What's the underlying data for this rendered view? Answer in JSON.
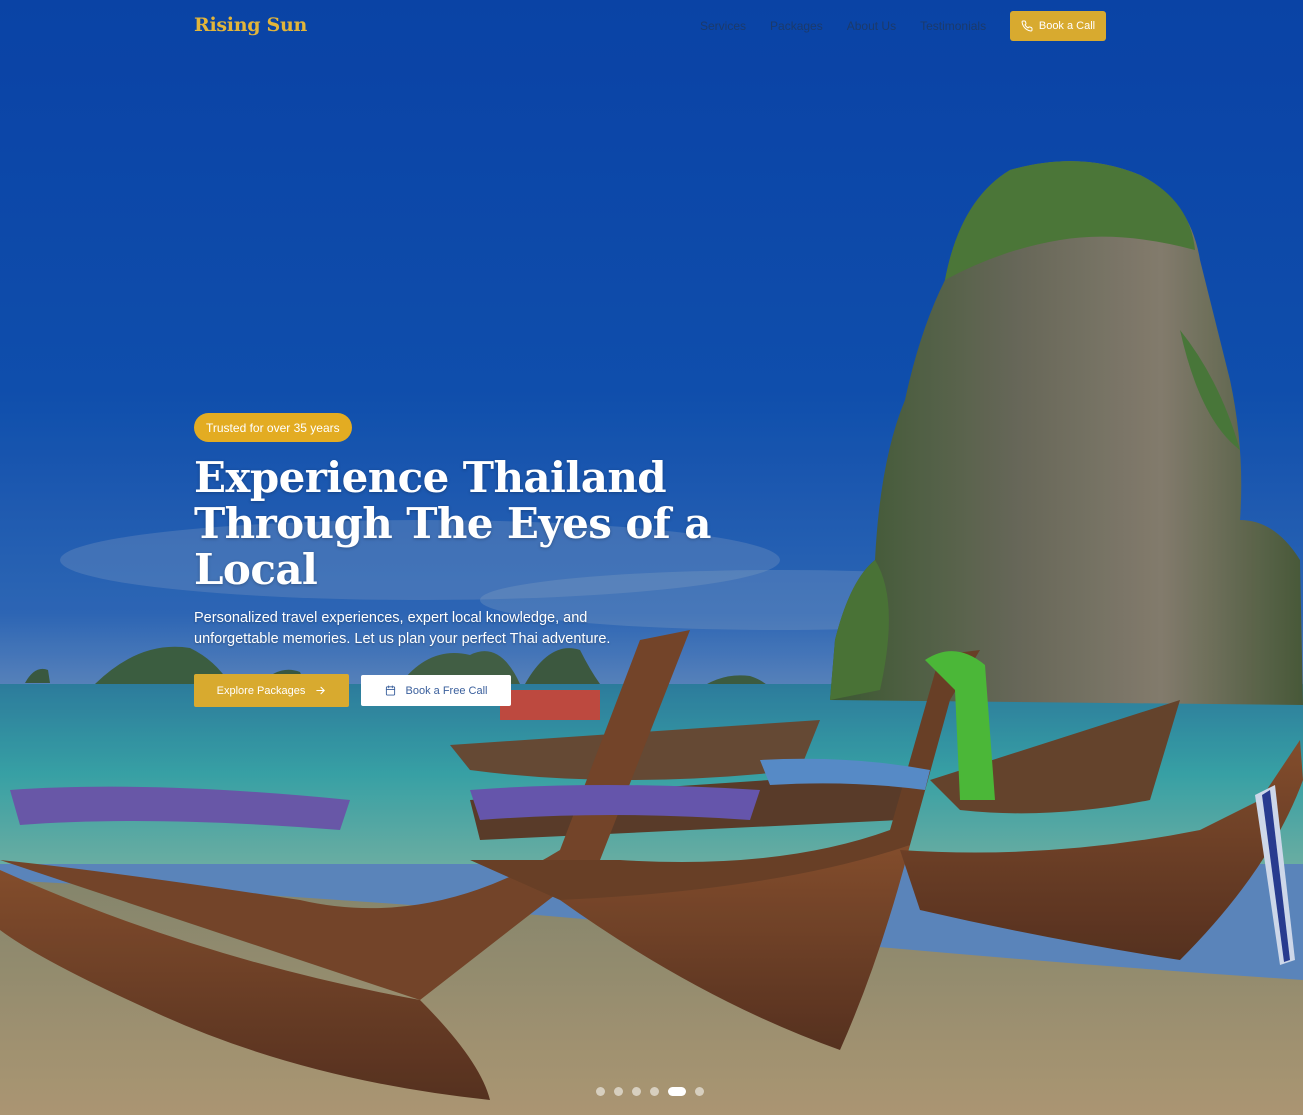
{
  "header": {
    "brand": "Rising Sun",
    "nav": [
      "Services",
      "Packages",
      "About Us",
      "Testimonials"
    ],
    "cta_label": "Book a Call"
  },
  "hero": {
    "badge": "Trusted for over 35 years",
    "headline_line1": "Experience Thailand",
    "headline_line2": "Through The Eyes of a",
    "headline_line3": "Local",
    "subtext": "Personalized travel experiences, expert local knowledge, and unforgettable memories. Let us plan your perfect Thai adventure.",
    "primary_button": "Explore Packages",
    "secondary_button": "Book a Free Call",
    "slides_total": 6,
    "active_slide": 5
  },
  "colors": {
    "accent": "#d8aa2f",
    "badge": "#e3ac22",
    "brand": "#e2b53a",
    "sky_top": "#0b44a5",
    "nav_text": "#1b3a6b"
  },
  "icons": {
    "cta": "phone-icon",
    "primary": "arrow-right-icon",
    "secondary": "calendar-icon"
  }
}
